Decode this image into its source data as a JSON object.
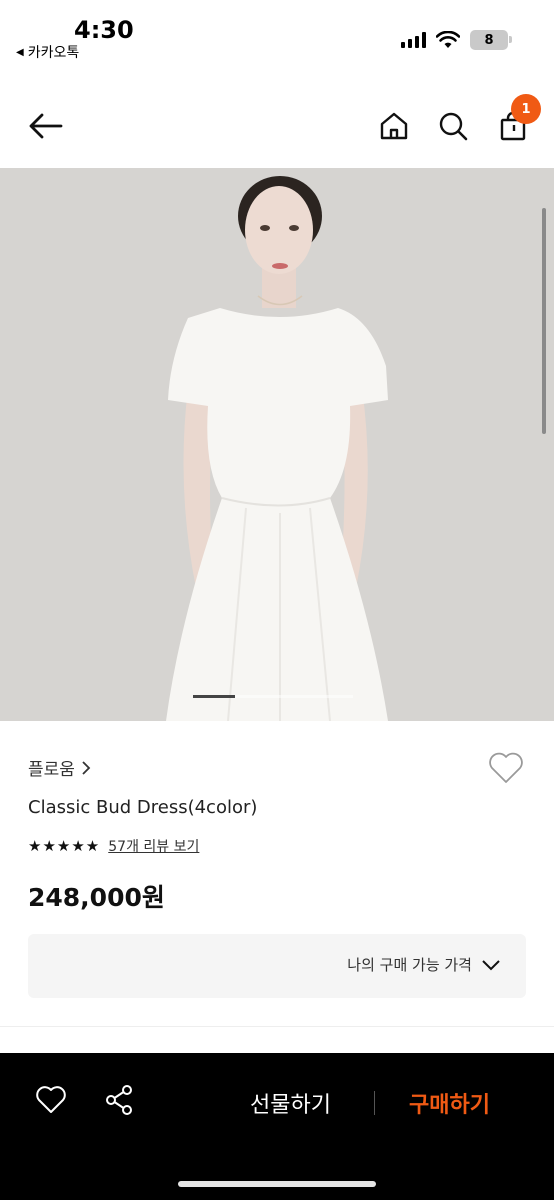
{
  "status_bar": {
    "time": "4:30",
    "back_app": "카카오톡",
    "battery": "8"
  },
  "navbar": {
    "cart_count": "1"
  },
  "colors": {
    "accent": "#f05a14",
    "bottom_bar": "#000000"
  },
  "product": {
    "brand": "플로움",
    "name": "Classic Bud Dress(4color)",
    "rating_stars": "★★★★★",
    "review_link": "57개 리뷰 보기",
    "price": "248,000원",
    "price_box_label": "나의 구매 가능 가격"
  },
  "gallery": {
    "current_index_fraction": 0.26
  },
  "bottom_bar": {
    "gift_label": "선물하기",
    "buy_label": "구매하기"
  }
}
